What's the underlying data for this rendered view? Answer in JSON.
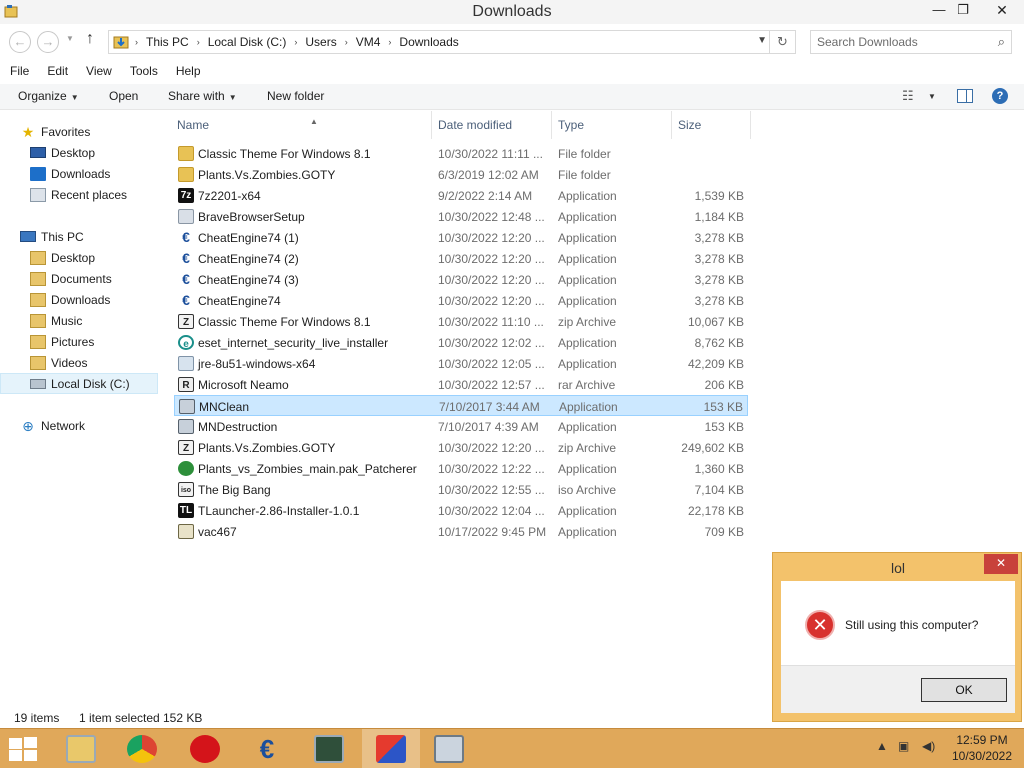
{
  "window": {
    "title": "Downloads",
    "controls": {
      "minimize": "—",
      "maximize": "❐",
      "close": "✕"
    }
  },
  "address": {
    "breadcrumbs": [
      "This PC",
      "Local Disk (C:)",
      "Users",
      "VM4",
      "Downloads"
    ],
    "separator": "›"
  },
  "search": {
    "placeholder": "Search Downloads"
  },
  "menu": [
    "File",
    "Edit",
    "View",
    "Tools",
    "Help"
  ],
  "toolbar": {
    "organize": "Organize",
    "open": "Open",
    "share": "Share with",
    "new_folder": "New folder",
    "help": "?"
  },
  "nav": {
    "favorites": "Favorites",
    "fav_items": [
      "Desktop",
      "Downloads",
      "Recent places"
    ],
    "this_pc": "This PC",
    "pc_items": [
      "Desktop",
      "Documents",
      "Downloads",
      "Music",
      "Pictures",
      "Videos",
      "Local Disk (C:)"
    ],
    "network": "Network"
  },
  "columns": {
    "name": "Name",
    "date": "Date modified",
    "type": "Type",
    "size": "Size"
  },
  "files": [
    {
      "name": "Classic Theme For Windows 8.1",
      "date": "10/30/2022 11:11 ...",
      "type": "File folder",
      "size": "",
      "icon": "folder-icon"
    },
    {
      "name": "Plants.Vs.Zombies.GOTY",
      "date": "6/3/2019 12:02 AM",
      "type": "File folder",
      "size": "",
      "icon": "folder-icon"
    },
    {
      "name": "7z2201-x64",
      "date": "9/2/2022 2:14 AM",
      "type": "Application",
      "size": "1,539 KB",
      "icon": "7zip-icon"
    },
    {
      "name": "BraveBrowserSetup",
      "date": "10/30/2022 12:48 ...",
      "type": "Application",
      "size": "1,184 KB",
      "icon": "brave-setup-icon"
    },
    {
      "name": "CheatEngine74 (1)",
      "date": "10/30/2022 12:20 ...",
      "type": "Application",
      "size": "3,278 KB",
      "icon": "cheat-engine-icon"
    },
    {
      "name": "CheatEngine74 (2)",
      "date": "10/30/2022 12:20 ...",
      "type": "Application",
      "size": "3,278 KB",
      "icon": "cheat-engine-icon"
    },
    {
      "name": "CheatEngine74 (3)",
      "date": "10/30/2022 12:20 ...",
      "type": "Application",
      "size": "3,278 KB",
      "icon": "cheat-engine-icon"
    },
    {
      "name": "CheatEngine74",
      "date": "10/30/2022 12:20 ...",
      "type": "Application",
      "size": "3,278 KB",
      "icon": "cheat-engine-icon"
    },
    {
      "name": "Classic Theme For Windows 8.1",
      "date": "10/30/2022 11:10 ...",
      "type": "zip Archive",
      "size": "10,067 KB",
      "icon": "zip-archive-icon"
    },
    {
      "name": "eset_internet_security_live_installer",
      "date": "10/30/2022 12:02 ...",
      "type": "Application",
      "size": "8,762 KB",
      "icon": "eset-icon"
    },
    {
      "name": "jre-8u51-windows-x64",
      "date": "10/30/2022 12:05 ...",
      "type": "Application",
      "size": "42,209 KB",
      "icon": "java-installer-icon"
    },
    {
      "name": "Microsoft Neamo",
      "date": "10/30/2022 12:57 ...",
      "type": "rar Archive",
      "size": "206 KB",
      "icon": "rar-archive-icon"
    },
    {
      "name": "MNClean",
      "date": "7/10/2017 3:44 AM",
      "type": "Application",
      "size": "153 KB",
      "icon": "application-icon",
      "selected": true
    },
    {
      "name": "MNDestruction",
      "date": "7/10/2017 4:39 AM",
      "type": "Application",
      "size": "153 KB",
      "icon": "application-icon"
    },
    {
      "name": "Plants.Vs.Zombies.GOTY",
      "date": "10/30/2022 12:20 ...",
      "type": "zip Archive",
      "size": "249,602 KB",
      "icon": "zip-archive-icon"
    },
    {
      "name": "Plants_vs_Zombies_main.pak_Patcherer",
      "date": "10/30/2022 12:22 ...",
      "type": "Application",
      "size": "1,360 KB",
      "icon": "patcher-icon"
    },
    {
      "name": "The Big Bang",
      "date": "10/30/2022 12:55 ...",
      "type": "iso Archive",
      "size": "7,104 KB",
      "icon": "iso-archive-icon"
    },
    {
      "name": "TLauncher-2.86-Installer-1.0.1",
      "date": "10/30/2022 12:04 ...",
      "type": "Application",
      "size": "22,178 KB",
      "icon": "tlauncher-icon"
    },
    {
      "name": "vac467",
      "date": "10/17/2022 9:45 PM",
      "type": "Application",
      "size": "709 KB",
      "icon": "vac-icon"
    }
  ],
  "status": {
    "count": "19 items",
    "selected": "1 item selected",
    "size": "152 KB"
  },
  "dialog": {
    "title": "lol",
    "close": "✕",
    "message": "Still using this computer?",
    "ok": "OK",
    "accent": "#f3c26b"
  },
  "taskbar": {
    "color": "#e0a85a",
    "time": "12:59 PM",
    "date": "10/30/2022"
  }
}
